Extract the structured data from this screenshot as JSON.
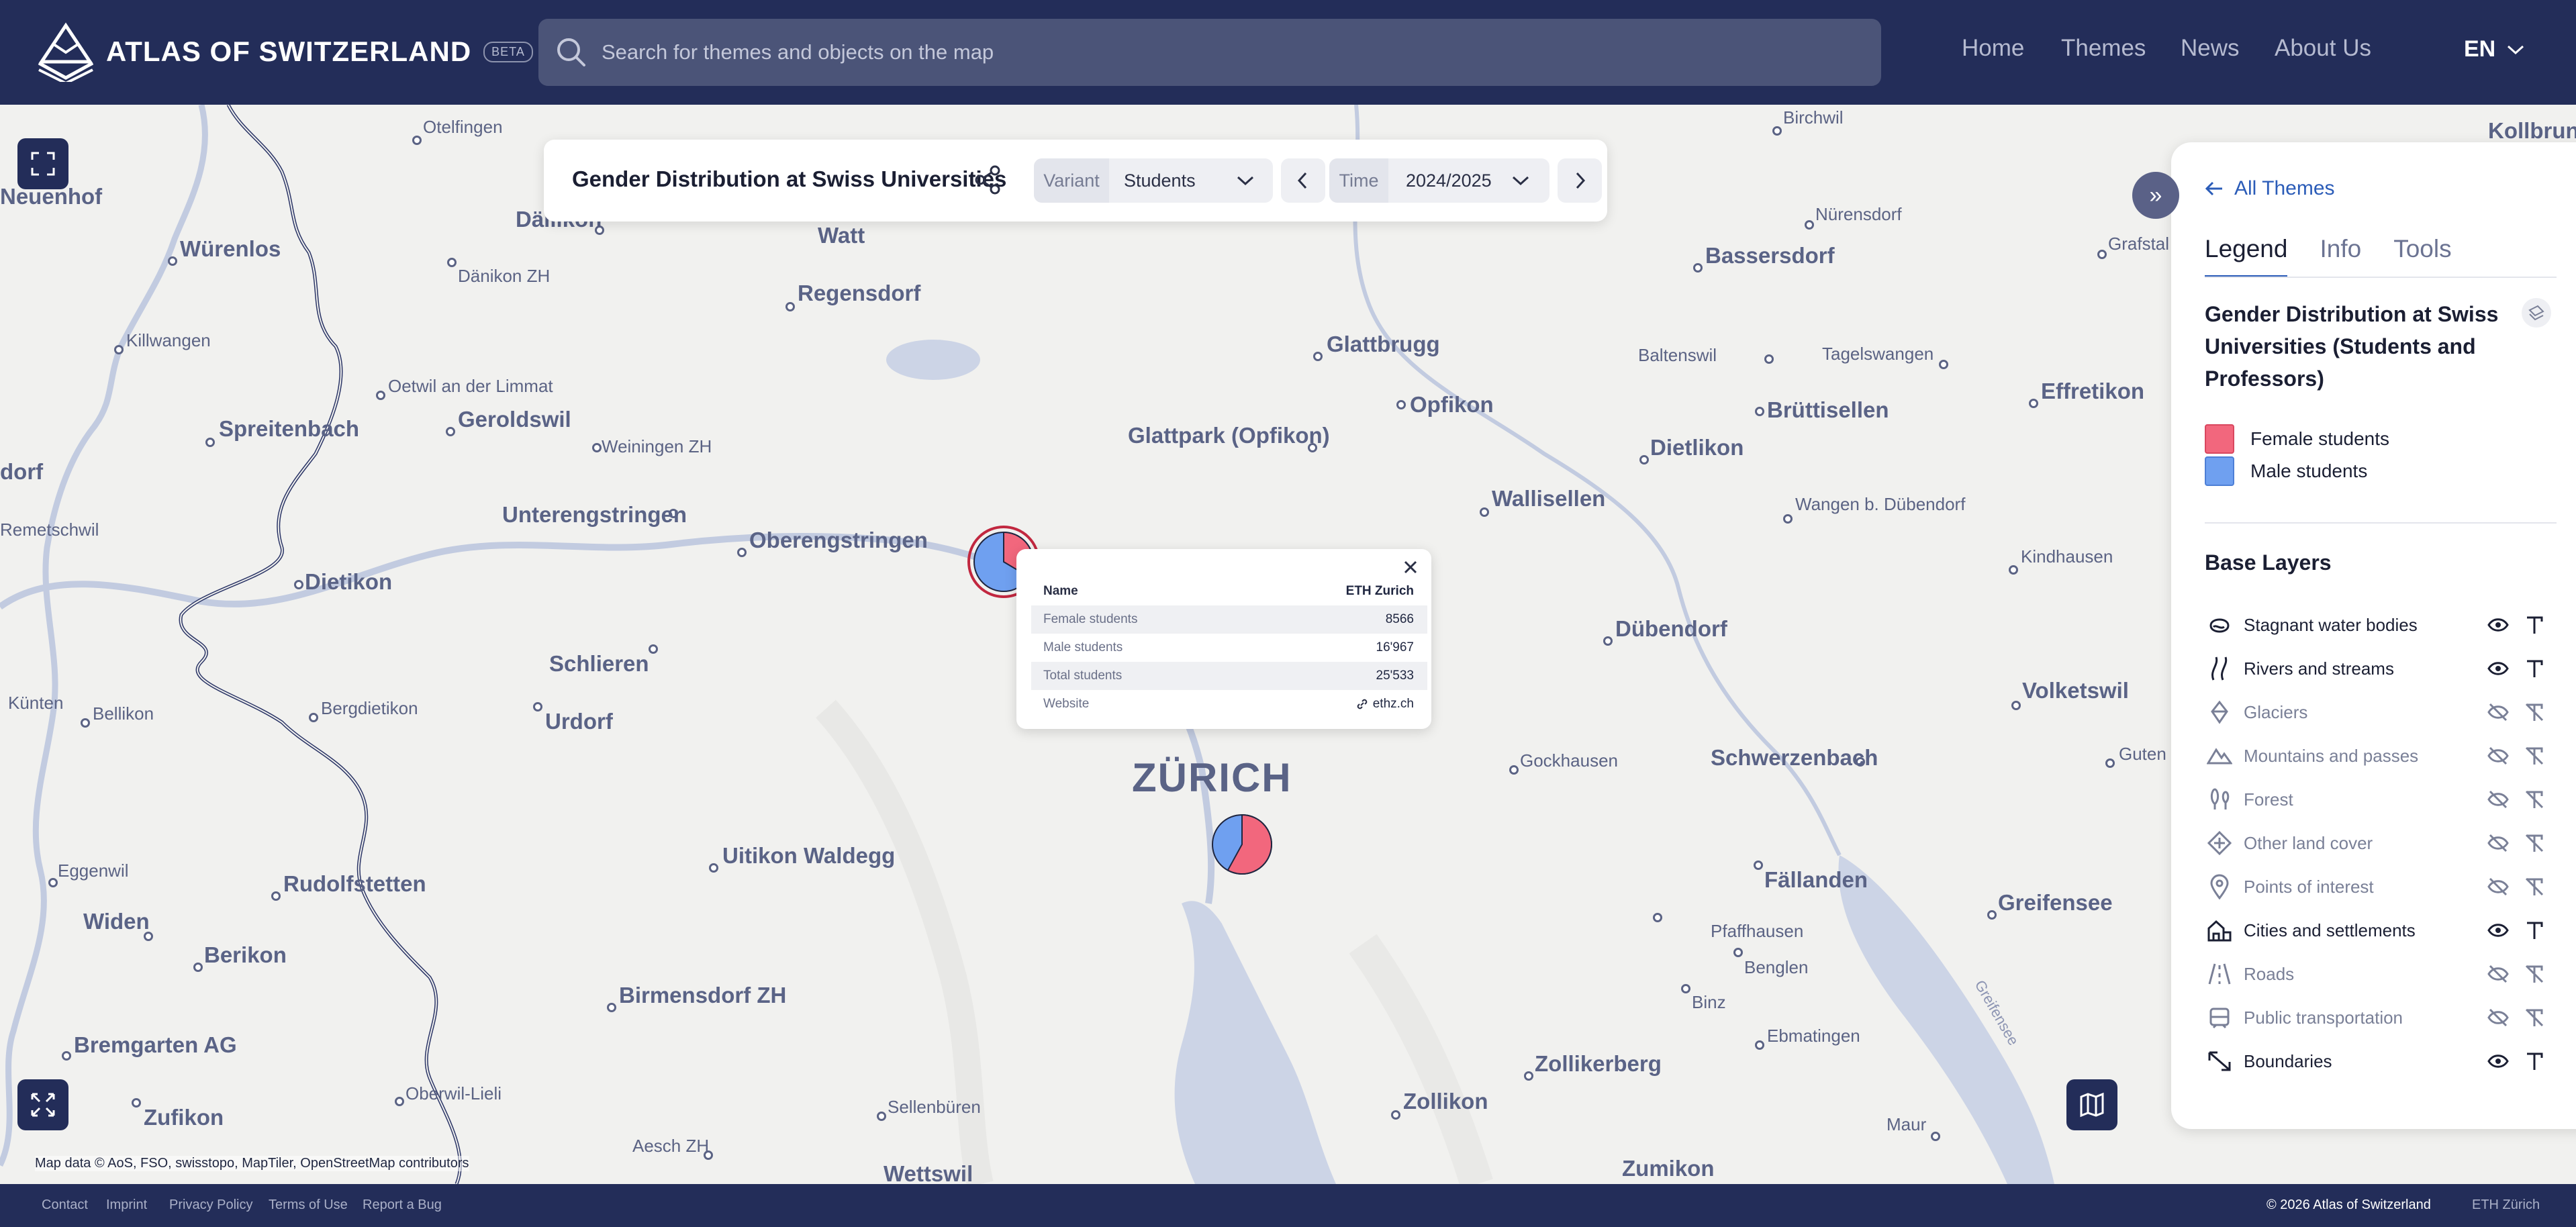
{
  "header": {
    "logo_text": "ATLAS OF SWITZERLAND",
    "beta_badge": "BETA",
    "search_placeholder": "Search for themes and objects on the map",
    "nav": [
      "Home",
      "Themes",
      "News",
      "About Us"
    ],
    "language": "EN"
  },
  "themebar": {
    "title": "Gender Distribution at Swiss Universities",
    "variant_label": "Variant",
    "variant_value": "Students",
    "time_label": "Time",
    "time_value": "2024/2025"
  },
  "popup": {
    "rows": [
      {
        "key": "Name",
        "value": "ETH Zurich"
      },
      {
        "key": "Female students",
        "value": "8566"
      },
      {
        "key": "Male students",
        "value": "16'967"
      },
      {
        "key": "Total students",
        "value": "25'533"
      },
      {
        "key": "Website",
        "value": "ethz.ch"
      }
    ]
  },
  "map": {
    "attribution": "Map data © AoS, FSO, swisstopo, MapTiler, OpenStreetMap contributors",
    "places": [
      "Otelfingen",
      "Neuenhof",
      "Würenlos",
      "Dällikon",
      "Watt",
      "Dänikon ZH",
      "Regensdorf",
      "Killwangen",
      "Oetwil an der Limmat",
      "Geroldswil",
      "Spreitenbach",
      "Weiningen ZH",
      "dorf",
      "Remetschwil",
      "Unterengstringen",
      "Oberengstringen",
      "Dietikon",
      "Schlieren",
      "Künten",
      "Bellikon",
      "Bergdietikon",
      "Urdorf",
      "ZÜRICH",
      "Uitikon Waldegg",
      "Eggenwil",
      "Rudolfstetten",
      "Widen",
      "Berikon",
      "Birmensdorf ZH",
      "Bremgarten AG",
      "Oberwil-Lieli",
      "Zufikon",
      "Sellenbüren",
      "Aesch ZH",
      "Wettswil",
      "Birchwil",
      "Kollbrunn",
      "Nürensdorf",
      "Grafstal",
      "Bassersdorf",
      "Glattbrugg",
      "Opfikon",
      "Baltenswil",
      "Tagelswangen",
      "Effretikon",
      "Glattpark (Opfikon)",
      "Brüttisellen",
      "Dietlikon",
      "Wallisellen",
      "Wangen b. Dübendorf",
      "Kindhausen",
      "Dübendorf",
      "Volketswil",
      "Gockhausen",
      "Schwerzenbach",
      "Guten",
      "Fällanden",
      "Greifensee",
      "Pfaffhausen",
      "Benglen",
      "Binz",
      "Ebmatingen",
      "Zollikerberg",
      "Zollikon",
      "Maur",
      "Zumikon",
      "Greifensee"
    ],
    "pie_main": {
      "female_fraction": 0.3355,
      "male_fraction": 0.6645
    },
    "pie_zurich": {
      "female_fraction": 0.58,
      "male_fraction": 0.42
    }
  },
  "panel": {
    "all_themes": "All Themes",
    "tabs": [
      "Legend",
      "Info",
      "Tools"
    ],
    "legend_title": "Gender Distribution at Swiss Universities (Students and Professors)",
    "legend": [
      {
        "label": "Female students",
        "color": "#f2677d"
      },
      {
        "label": "Male students",
        "color": "#6fa0f0"
      }
    ],
    "base_layers_title": "Base Layers",
    "layers": [
      {
        "label": "Stagnant water bodies",
        "visible": true
      },
      {
        "label": "Rivers and streams",
        "visible": true
      },
      {
        "label": "Glaciers",
        "visible": false
      },
      {
        "label": "Mountains and passes",
        "visible": false
      },
      {
        "label": "Forest",
        "visible": false
      },
      {
        "label": "Other land cover",
        "visible": false
      },
      {
        "label": "Points of interest",
        "visible": false
      },
      {
        "label": "Cities and settlements",
        "visible": true
      },
      {
        "label": "Roads",
        "visible": false
      },
      {
        "label": "Public transportation",
        "visible": false
      },
      {
        "label": "Boundaries",
        "visible": true
      }
    ]
  },
  "footer": {
    "links": [
      "Contact",
      "Imprint",
      "Privacy Policy",
      "Terms of Use",
      "Report a Bug"
    ],
    "copyright": "© 2026 Atlas of Switzerland",
    "eth": "ETH Zürich"
  },
  "colors": {
    "header_bg": "#232d59",
    "accent": "#2b5cb8",
    "female": "#f2677d",
    "male": "#6fa0f0"
  }
}
